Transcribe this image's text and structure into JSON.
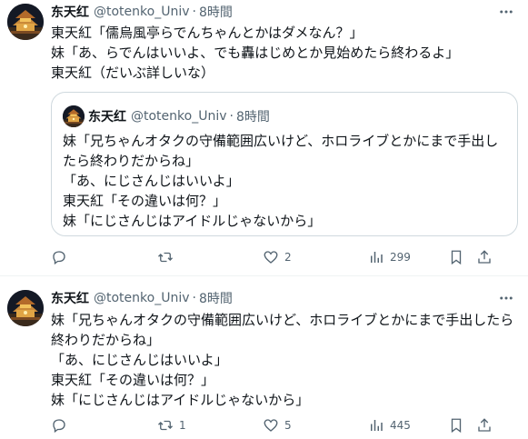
{
  "tweets": [
    {
      "author": {
        "name": "东天红",
        "handle": "@totenko_Univ",
        "separator": "·",
        "time": "8時間"
      },
      "lines": [
        "東天紅「儒烏風亭らでんちゃんとかはダメなん？」",
        "妹「あ、らでんはいいよ、でも轟はじめとか見始めたら終わるよ」",
        "東天紅（だいぶ詳しいな）"
      ],
      "quote": {
        "author": {
          "name": "东天红",
          "handle": "@totenko_Univ",
          "separator": "·",
          "time": "8時間"
        },
        "lines": [
          "妹「兄ちゃんオタクの守備範囲広いけど、ホロライブとかにまで手出し",
          "たら終わりだからね」",
          "「あ、にじさんじはいいよ」",
          "東天紅「その違いは何？」",
          "妹「にじさんじはアイドルじゃないから」"
        ]
      },
      "actions": {
        "reply": "",
        "retweet": "",
        "like": "2",
        "views": "299"
      }
    },
    {
      "author": {
        "name": "东天红",
        "handle": "@totenko_Univ",
        "separator": "·",
        "time": "8時間"
      },
      "lines": [
        "妹「兄ちゃんオタクの守備範囲広いけど、ホロライブとかにまで手出したら",
        "終わりだからね」",
        "「あ、にじさんじはいいよ」",
        "東天紅「その違いは何？」",
        "妹「にじさんじはアイドルじゃないから」"
      ],
      "actions": {
        "reply": "",
        "retweet": "1",
        "like": "5",
        "views": "445"
      }
    }
  ],
  "icons": {
    "more": "more-horizontal-icon",
    "reply": "reply-icon",
    "retweet": "retweet-icon",
    "like": "heart-icon",
    "views": "views-icon",
    "bookmark": "bookmark-icon",
    "share": "share-icon"
  },
  "colors": {
    "text": "#0f1419",
    "secondary": "#536471",
    "border": "#cfd9de",
    "divider": "#eff3f4"
  }
}
